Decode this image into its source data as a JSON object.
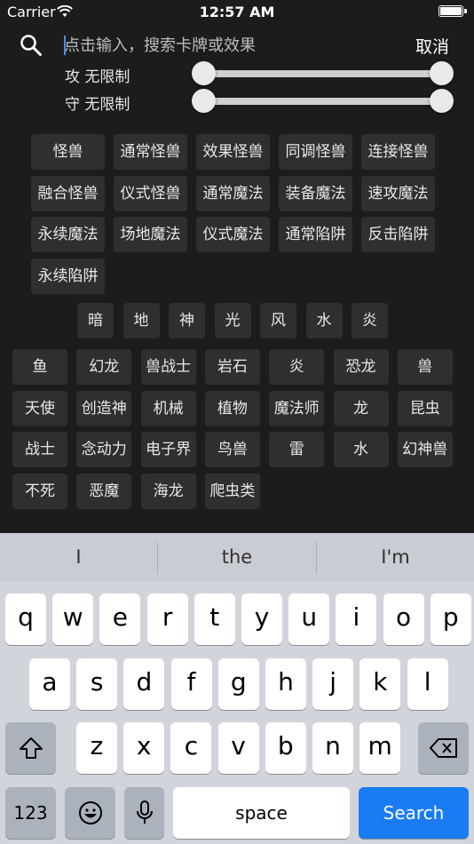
{
  "status": {
    "carrier": "Carrier",
    "time": "12:57 AM"
  },
  "search": {
    "placeholder": "点击输入，搜索卡牌或效果",
    "cancel": "取消"
  },
  "filters": {
    "atk_label": "攻 无限制",
    "def_label": "守 无限制"
  },
  "card_types": [
    "怪兽",
    "通常怪兽",
    "效果怪兽",
    "同调怪兽",
    "连接怪兽",
    "融合怪兽",
    "仪式怪兽",
    "通常魔法",
    "装备魔法",
    "速攻魔法",
    "永续魔法",
    "场地魔法",
    "仪式魔法",
    "通常陷阱",
    "反击陷阱",
    "永续陷阱"
  ],
  "attributes": [
    "暗",
    "地",
    "神",
    "光",
    "风",
    "水",
    "炎"
  ],
  "races": [
    "鱼",
    "幻龙",
    "兽战士",
    "岩石",
    "炎",
    "恐龙",
    "兽",
    "天使",
    "创造神",
    "机械",
    "植物",
    "魔法师",
    "龙",
    "昆虫",
    "战士",
    "念动力",
    "电子界",
    "鸟兽",
    "雷",
    "水",
    "幻神兽",
    "不死",
    "恶魔",
    "海龙",
    "爬虫类"
  ],
  "keyboard": {
    "suggestions": [
      "I",
      "the",
      "I'm"
    ],
    "row1": [
      "q",
      "w",
      "e",
      "r",
      "t",
      "y",
      "u",
      "i",
      "o",
      "p"
    ],
    "row2": [
      "a",
      "s",
      "d",
      "f",
      "g",
      "h",
      "j",
      "k",
      "l"
    ],
    "row3": [
      "z",
      "x",
      "c",
      "v",
      "b",
      "n",
      "m"
    ],
    "numbers_label": "123",
    "space_label": "space",
    "search_label": "Search"
  }
}
